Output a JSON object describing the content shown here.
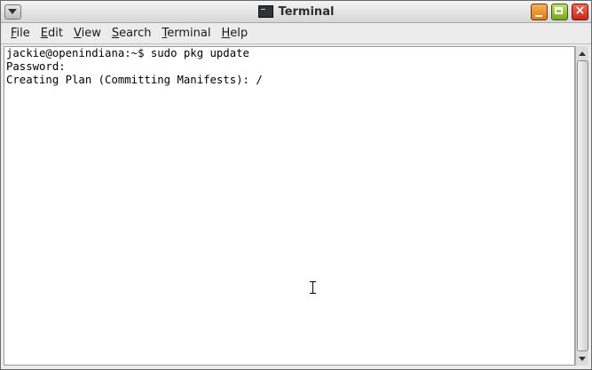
{
  "window": {
    "title": "Terminal"
  },
  "menubar": {
    "items": [
      {
        "label_mn": "F",
        "label_rest": "ile"
      },
      {
        "label_mn": "E",
        "label_rest": "dit"
      },
      {
        "label_mn": "V",
        "label_rest": "iew"
      },
      {
        "label_mn": "S",
        "label_rest": "earch"
      },
      {
        "label_mn": "T",
        "label_rest": "erminal"
      },
      {
        "label_mn": "H",
        "label_rest": "elp"
      }
    ]
  },
  "terminal": {
    "lines": [
      "jackie@openindiana:~$ sudo pkg update",
      "Password:",
      "Creating Plan (Committing Manifests): /"
    ]
  },
  "icons": {
    "window_menu": "window-menu-icon",
    "app": "terminal-app-icon",
    "minimize": "minimize-icon",
    "maximize": "maximize-icon",
    "close": "close-icon",
    "scroll_up": "arrow-up-icon",
    "scroll_down": "arrow-down-icon",
    "cursor": "text-cursor-icon"
  },
  "colors": {
    "minimize": "#e07a12",
    "maximize": "#76a71e",
    "close": "#c8261a",
    "terminal_bg": "#ffffff",
    "terminal_fg": "#000000"
  }
}
